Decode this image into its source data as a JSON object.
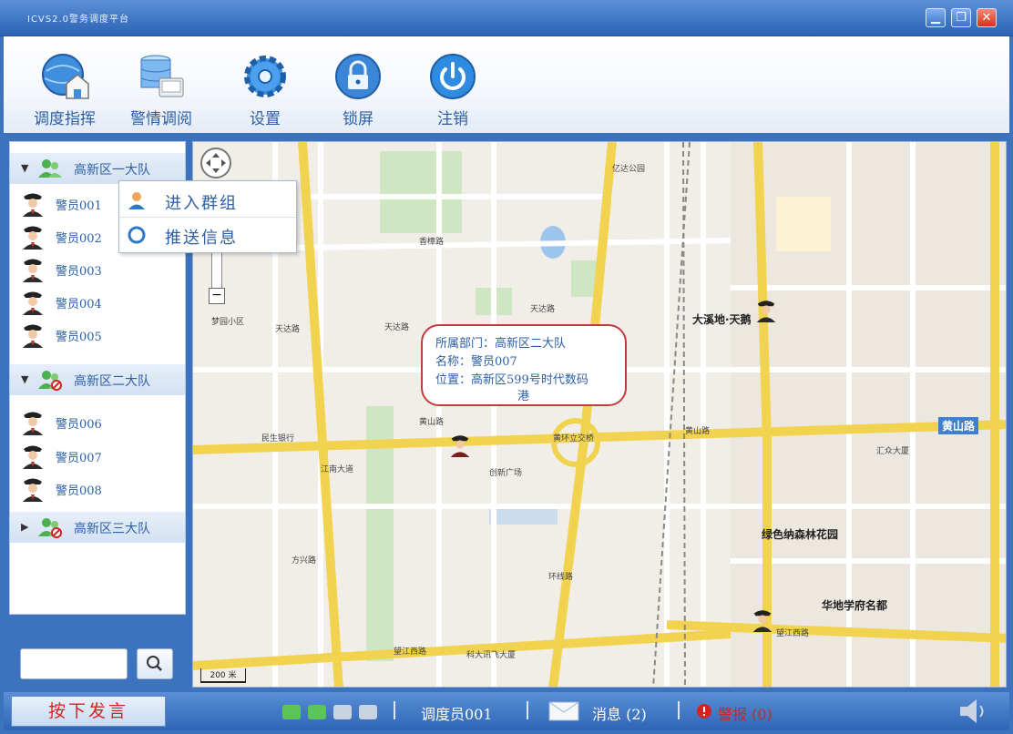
{
  "window": {
    "title": "ICVS2.0警务调度平台",
    "minimize_label": "▁",
    "restore_label": "❐",
    "close_label": "✕"
  },
  "toolbar": {
    "items": [
      {
        "label": "调度指挥",
        "icon": "globe-home-icon"
      },
      {
        "label": "警情调阅",
        "icon": "database-icon"
      },
      {
        "label": "设置",
        "icon": "gear-icon"
      },
      {
        "label": "锁屏",
        "icon": "lock-icon"
      },
      {
        "label": "注销",
        "icon": "power-icon"
      }
    ]
  },
  "sidebar": {
    "groups": [
      {
        "name": "高新区一大队",
        "expanded": true,
        "officers": [
          "警员001",
          "警员002",
          "警员003",
          "警员004",
          "警员005"
        ]
      },
      {
        "name": "高新区二大队",
        "expanded": true,
        "officers": [
          "警员006",
          "警员007",
          "警员008"
        ]
      },
      {
        "name": "高新区三大队",
        "expanded": false,
        "officers": []
      }
    ],
    "search": {
      "value": ""
    }
  },
  "context_menu": {
    "items": [
      {
        "label": "进入群组",
        "icon": "group-user-icon"
      },
      {
        "label": "推送信息",
        "icon": "push-message-icon"
      }
    ]
  },
  "map": {
    "scale": "200 米",
    "info_bubble": {
      "department": "所属部门：高新区二大队",
      "name": "名称：警员007",
      "location_line1": "位置：高新区599号时代数码",
      "location_line2": "港"
    },
    "labels": {
      "l1": "黄山路",
      "l2": "黄山路",
      "l3": "黄山路",
      "l4": "黄环立交桥",
      "l5": "大溪地·天鹅",
      "l6": "绿色纳森林花园",
      "l7": "华地学府名都",
      "l8": "望江西路",
      "l9": "望江西路",
      "l10": "天达路",
      "l11": "天达路",
      "l12": "天达路",
      "l13": "创新广场",
      "l14": "江南大道",
      "l15": "民生银行",
      "l16": "方兴路",
      "l17": "梦园小区",
      "l18": "香樟路",
      "l19": "汇众大厦",
      "l20": "科大讯飞大厦",
      "l21": "环线路",
      "l22": "亿达公园"
    }
  },
  "statusbar": {
    "ptt_label": "按下发言",
    "dispatcher": "调度员001",
    "messages": "消息 (2)",
    "alarm": "警报 (0)"
  },
  "colors": {
    "frame": "#3d73bd",
    "accent_text": "#2d5fa5",
    "alarm": "#d42323",
    "bubble_border": "#c33b3b"
  }
}
